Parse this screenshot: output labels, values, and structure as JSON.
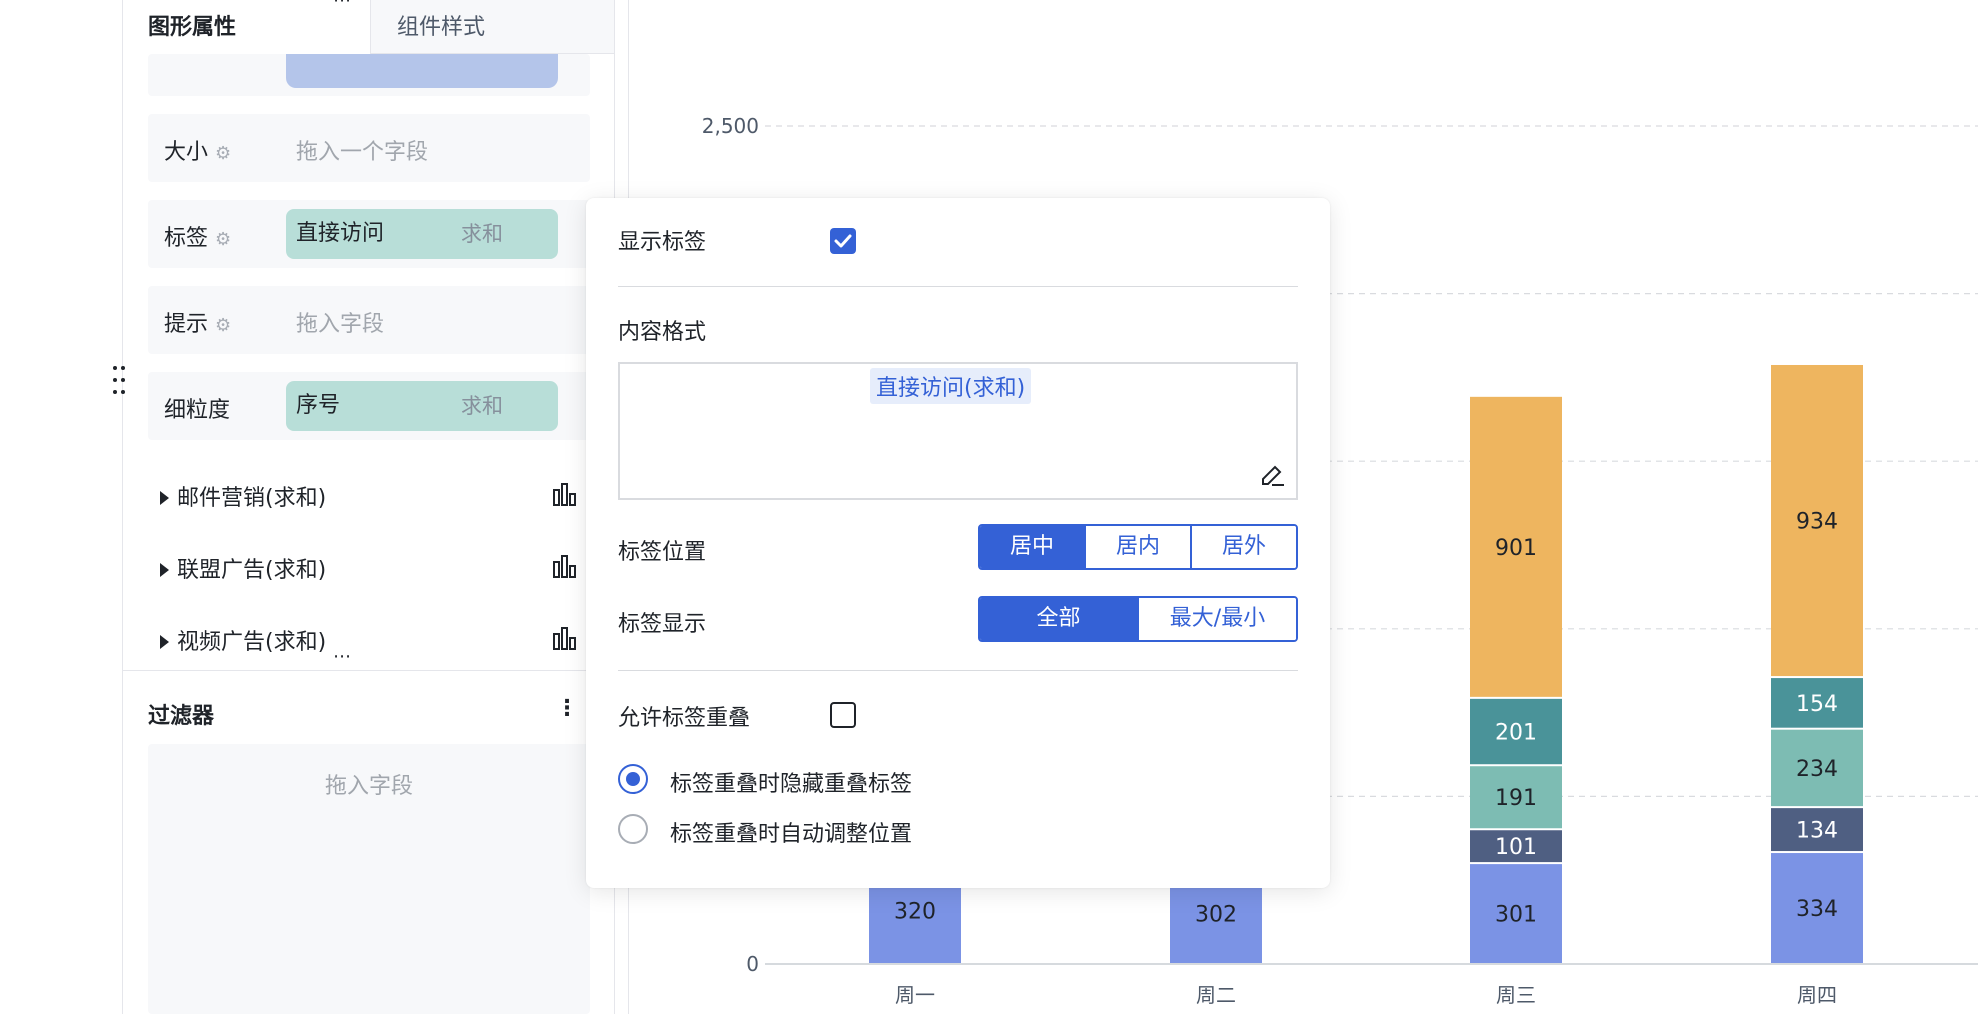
{
  "tabs": {
    "shape_props": "图形属性",
    "component_style": "组件样式"
  },
  "fields": {
    "size": {
      "label": "大小",
      "placeholder": "拖入一个字段"
    },
    "label": {
      "label": "标签",
      "field": "直接访问",
      "agg": "求和"
    },
    "tooltip": {
      "label": "提示",
      "placeholder": "拖入字段"
    },
    "granularity": {
      "label": "细粒度",
      "field": "序号",
      "agg": "求和"
    }
  },
  "series": [
    "邮件营销(求和)",
    "联盟广告(求和)",
    "视频广告(求和)"
  ],
  "filter": {
    "title": "过滤器",
    "placeholder": "拖入字段"
  },
  "popup": {
    "show_label": "显示标签",
    "content_format": "内容格式",
    "format_token": "直接访问(求和)",
    "label_position": "标签位置",
    "position_options": [
      "居中",
      "居内",
      "居外"
    ],
    "label_display": "标签显示",
    "display_options": [
      "全部",
      "最大/最小"
    ],
    "allow_overlap": "允许标签重叠",
    "overlap_hide": "标签重叠时隐藏重叠标签",
    "overlap_adjust": "标签重叠时自动调整位置"
  },
  "colors": {
    "accent": "#3461d6",
    "pill_teal": "#b8ded8",
    "series_blue": "#7b93e5",
    "series_navy": "#4f5f82",
    "series_teal_light": "#7dbcb3",
    "series_teal_dark": "#4a9399",
    "series_orange": "#eeb55f"
  },
  "chart_data": {
    "type": "bar",
    "stacked": true,
    "categories": [
      "周一",
      "周二",
      "周三",
      "周四"
    ],
    "y_ticks": [
      "0",
      "2,500"
    ],
    "ylim": [
      0,
      2500
    ],
    "grid": true,
    "stacks": [
      [
        320
      ],
      [
        302
      ],
      [
        301,
        101,
        191,
        201,
        901
      ],
      [
        334,
        134,
        234,
        154,
        934
      ]
    ],
    "segment_colors": [
      "#7b93e5",
      "#4f5f82",
      "#7dbcb3",
      "#4a9399",
      "#eeb55f"
    ]
  }
}
